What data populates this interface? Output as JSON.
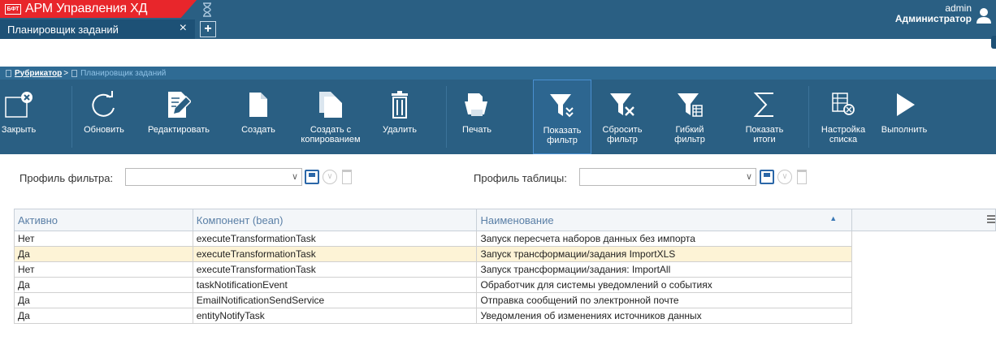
{
  "app": {
    "logo_text": "БФТ",
    "title": "АРМ Управления ХД"
  },
  "user": {
    "name": "admin",
    "role": "Администратор"
  },
  "tabs": [
    {
      "label": "Планировщик заданий",
      "close": "×"
    }
  ],
  "tab_add": "+",
  "breadcrumb": {
    "root": "Рубрикатор",
    "separator": ">",
    "current": "Планировщик заданий"
  },
  "toolbar": [
    {
      "id": "close",
      "label": "Закрыть",
      "icon": "close-window-icon"
    },
    {
      "id": "refresh",
      "label": "Обновить",
      "icon": "refresh-icon"
    },
    {
      "id": "edit",
      "label": "Редактировать",
      "icon": "edit-icon"
    },
    {
      "id": "create",
      "label": "Создать",
      "icon": "new-document-icon"
    },
    {
      "id": "copy",
      "label": "Создать с копированием",
      "icon": "copy-document-icon"
    },
    {
      "id": "delete",
      "label": "Удалить",
      "icon": "trash-icon"
    },
    {
      "id": "print",
      "label": "Печать",
      "icon": "printer-icon"
    },
    {
      "id": "show_filter",
      "label": "Показать фильтр",
      "icon": "filter-show-icon"
    },
    {
      "id": "reset_filter",
      "label": "Сбросить фильтр",
      "icon": "filter-reset-icon"
    },
    {
      "id": "flex_filter",
      "label": "Гибкий фильтр",
      "icon": "filter-flex-icon"
    },
    {
      "id": "totals",
      "label": "Показать итоги",
      "icon": "sigma-icon"
    },
    {
      "id": "list_settings",
      "label": "Настройка списка",
      "icon": "list-settings-icon"
    },
    {
      "id": "run",
      "label": "Выполнить",
      "icon": "play-icon"
    }
  ],
  "filter_profile": {
    "label": "Профиль фильтра:",
    "value": ""
  },
  "table_profile": {
    "label": "Профиль таблицы:",
    "value": ""
  },
  "grid": {
    "columns": [
      "Активно",
      "Компонент (bean)",
      "Наименование"
    ],
    "sorted_column": 2,
    "rows": [
      [
        "Нет",
        "executeTransformationTask",
        "Запуск пересчета наборов данных без импорта"
      ],
      [
        "Да",
        "executeTransformationTask",
        "Запуск трансформации/задания ImportXLS"
      ],
      [
        "Нет",
        "executeTransformationTask",
        "Запуск трансформации/задания: ImportAll"
      ],
      [
        "Да",
        "taskNotificationEvent",
        "Обработчик для системы уведомлений о событиях"
      ],
      [
        "Да",
        "EmailNotificationSendService",
        "Отправка сообщений по электронной почте"
      ],
      [
        "Да",
        "entityNotifyTask",
        "Уведомления об изменениях источников данных"
      ]
    ],
    "selected_row": 1
  },
  "colors": {
    "header": "#2a5f83",
    "brand": "#e8262b",
    "selected_row": "#fdf3d6"
  }
}
